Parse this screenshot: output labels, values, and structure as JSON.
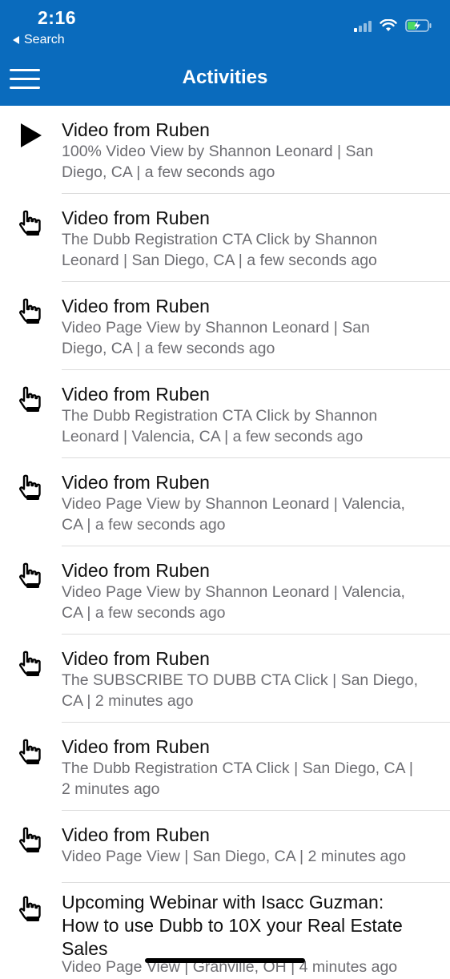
{
  "status_bar": {
    "time": "2:16",
    "back_label": "Search"
  },
  "header": {
    "title": "Activities",
    "color": "#0a6bbd"
  },
  "activities": [
    {
      "icon": "play-icon",
      "title": "Video from Ruben",
      "line1": "100% Video View by Shannon Leonard | San",
      "line2": "Diego, CA | a few seconds ago"
    },
    {
      "icon": "pointer-hand-icon",
      "title": "Video from Ruben",
      "line1": "The Dubb Registration CTA Click by Shannon",
      "line2": "Leonard | San Diego, CA | a few seconds ago"
    },
    {
      "icon": "pointer-hand-icon",
      "title": "Video from Ruben",
      "line1": "Video Page View by Shannon Leonard | San",
      "line2": "Diego, CA | a few seconds ago"
    },
    {
      "icon": "pointer-hand-icon",
      "title": "Video from Ruben",
      "line1": "The Dubb Registration CTA Click by Shannon",
      "line2": "Leonard | Valencia, CA | a few seconds ago"
    },
    {
      "icon": "pointer-hand-icon",
      "title": "Video from Ruben",
      "line1": "Video Page View by Shannon Leonard | Valencia,",
      "line2": "CA | a few seconds ago"
    },
    {
      "icon": "pointer-hand-icon",
      "title": "Video from Ruben",
      "line1": "Video Page View by Shannon Leonard | Valencia,",
      "line2": "CA | a few seconds ago"
    },
    {
      "icon": "pointer-hand-icon",
      "title": "Video from Ruben",
      "line1": "The SUBSCRIBE TO DUBB CTA Click | San Diego,",
      "line2": "CA | 2 minutes ago"
    },
    {
      "icon": "pointer-hand-icon",
      "title": "Video from Ruben",
      "line1": "The Dubb Registration CTA Click | San Diego, CA |",
      "line2": "2 minutes ago"
    },
    {
      "icon": "pointer-hand-icon",
      "title": "Video from Ruben",
      "line1": "Video Page View | San Diego, CA | 2 minutes ago",
      "line2": ""
    },
    {
      "icon": "pointer-hand-icon",
      "title_l1": "Upcoming Webinar with Isacc Guzman:",
      "title_l2": "How to use Dubb to 10X your Real Estate",
      "title_l3": "Sales",
      "line1": "Video Page View | Granville, OH | 4 minutes ago"
    }
  ]
}
